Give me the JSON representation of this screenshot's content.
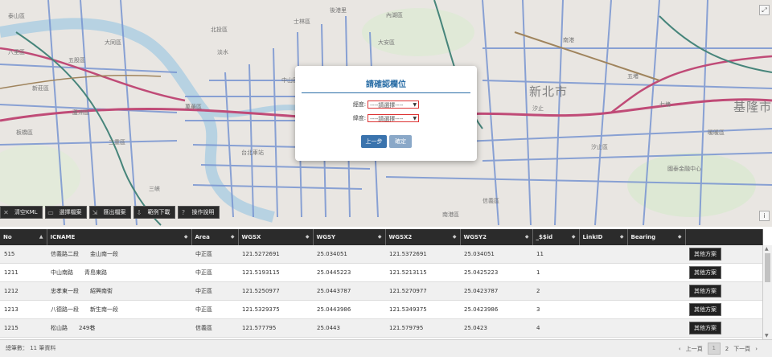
{
  "map": {
    "labels": [
      "新北市",
      "基隆市",
      "汐止區",
      "南港區",
      "士林區",
      "大安區",
      "北投區",
      "中山區",
      "五股區",
      "三重區",
      "蘆洲區",
      "板橋區",
      "萬華區",
      "信義區",
      "內湖區",
      "大同區",
      "汐止",
      "七堵",
      "暖暖區",
      "泰山區",
      "新莊區",
      "三峽",
      "國泰金融中心",
      "八里區",
      "淡水",
      "後港里",
      "台北車站",
      "南港",
      "五堵"
    ],
    "expand_icon": "expand-icon",
    "info_icon": "info-icon"
  },
  "toolbar": {
    "items": [
      {
        "label": "清空KML",
        "icon": "close-icon"
      },
      {
        "label": "選擇檔案",
        "icon": "file-icon"
      },
      {
        "label": "匯出檔案",
        "icon": "export-icon"
      },
      {
        "label": "範例下載",
        "icon": "download-icon"
      },
      {
        "label": "操作說明",
        "icon": "help-icon"
      }
    ]
  },
  "dialog": {
    "title": "請確認欄位",
    "longitude_label": "經度:",
    "longitude_value": "----請選擇----",
    "latitude_label": "緯度:",
    "latitude_value": "----請選擇----",
    "prev_button": "上一步",
    "ok_button": "確定"
  },
  "table": {
    "columns": [
      "No",
      "ICNAME",
      "Area",
      "WGSX",
      "WGSY",
      "WGSX2",
      "WGSY2",
      "_$$id",
      "LinkID",
      "Bearing",
      ""
    ],
    "rows": [
      [
        "515",
        "信義路二段　　金山南一段",
        "中正區",
        "121.5272691",
        "25.034051",
        "121.5372691",
        "25.034051",
        "11",
        "",
        "",
        "其他方案"
      ],
      [
        "1211",
        "中山南路　　青島東路",
        "中正區",
        "121.5193115",
        "25.0445223",
        "121.5213115",
        "25.0425223",
        "1",
        "",
        "",
        "其他方案"
      ],
      [
        "1212",
        "忠孝東一段　　紹興南街",
        "中正區",
        "121.5250977",
        "25.0443787",
        "121.5270977",
        "25.0423787",
        "2",
        "",
        "",
        "其他方案"
      ],
      [
        "1213",
        "八德路一段　　新生南一段",
        "中正區",
        "121.5329375",
        "25.0443986",
        "121.5349375",
        "25.0423986",
        "3",
        "",
        "",
        "其他方案"
      ],
      [
        "1215",
        "松山路　　249巷",
        "信義區",
        "121.577795",
        "25.0443",
        "121.579795",
        "25.0423",
        "4",
        "",
        "",
        "其他方案"
      ]
    ]
  },
  "footer": {
    "total": "總筆數： 11 筆資料",
    "prev": "上一頁",
    "page1": "1",
    "page2": "2",
    "next": "下一頁"
  }
}
